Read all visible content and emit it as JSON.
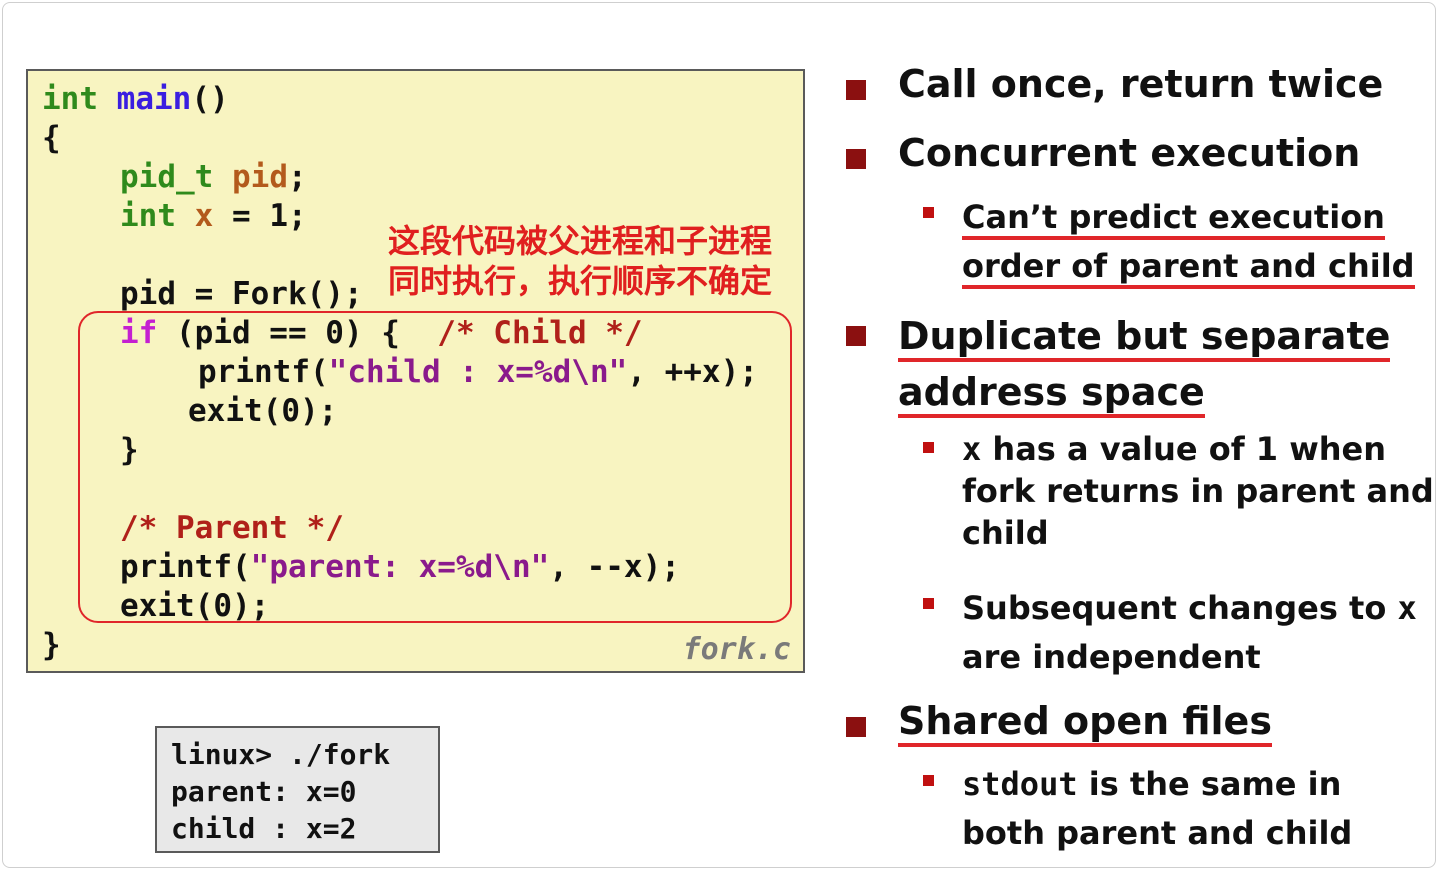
{
  "code": {
    "l1_int": "int",
    "l1_main": "main",
    "l1_rest": "()",
    "l2": "{",
    "l3_type": "pid_t",
    "l3_var": "pid",
    "l3_end": ";",
    "l4_type": "int",
    "l4_var": "x",
    "l4_rest": " = 1;",
    "l6": "pid = Fork();",
    "l7_if": "if",
    "l7_rest": " (pid == 0) {  ",
    "l7_cmt": "/* Child */",
    "l8_a": "printf(",
    "l8_str": "\"child : x=%d\\n\"",
    "l8_b": ", ++x);",
    "l9": "exit(0);",
    "l10": "}",
    "l12_cmt": "/* Parent */",
    "l13_a": "printf(",
    "l13_str": "\"parent: x=%d\\n\"",
    "l13_b": ", --x);",
    "l14": "exit(0);",
    "l15": "}",
    "filename": "fork.c",
    "annotation": "这段代码被父进程和子进程\n同时执行，执行顺序不确定"
  },
  "terminal": {
    "lines": [
      "linux> ./fork",
      "parent: x=0",
      "child : x=2"
    ]
  },
  "bullets": {
    "b1": "Call once, return twice",
    "b2": "Concurrent execution",
    "b2_1_l1": "Can’t predict execution",
    "b2_1_l2": "order of parent and child",
    "b3_l1": "Duplicate but separate",
    "b3_l2": "address space",
    "b3_1_x": "x",
    "b3_1_l1": " has a value of 1 when",
    "b3_1_l2": "fork returns in parent and",
    "b3_1_l3": "child",
    "b3_2_l1": "Subsequent changes to ",
    "b3_2_x": "x",
    "b3_2_l2": "are independent",
    "b4": "Shared open files",
    "b4_1_mono": "stdout",
    "b4_1_l1": " is the same in",
    "b4_1_l2": "both parent and child"
  },
  "colors": {
    "code_bg": "#f8f4c1",
    "bullet_square": "#8b1010",
    "underline_red": "#e0262a",
    "annotation_red": "#e01f1f"
  }
}
